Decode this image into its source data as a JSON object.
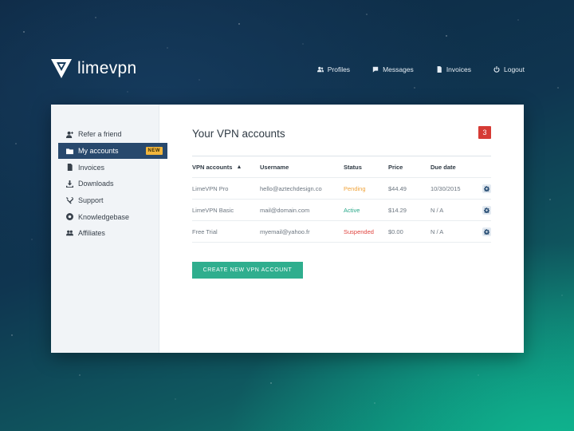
{
  "brand": {
    "name": "limevpn"
  },
  "nav": [
    {
      "label": "Profiles",
      "icon": "users-icon"
    },
    {
      "label": "Messages",
      "icon": "chat-icon"
    },
    {
      "label": "Invoices",
      "icon": "document-icon"
    },
    {
      "label": "Logout",
      "icon": "power-icon"
    }
  ],
  "sidebar": {
    "items": [
      {
        "label": "Refer a friend",
        "icon": "add-user-icon"
      },
      {
        "label": "My accounts",
        "icon": "folder-icon",
        "active": true,
        "badge": "NEW"
      },
      {
        "label": "Invoices",
        "icon": "document-icon"
      },
      {
        "label": "Downloads",
        "icon": "download-icon"
      },
      {
        "label": "Support",
        "icon": "tools-icon"
      },
      {
        "label": "Knowledgebase",
        "icon": "lifebuoy-icon"
      },
      {
        "label": "Affiliates",
        "icon": "group-icon"
      }
    ]
  },
  "main": {
    "title": "Your VPN accounts",
    "count": "3",
    "table": {
      "headers": [
        "VPN accounts",
        "Username",
        "Status",
        "Price",
        "Due date"
      ],
      "rows": [
        {
          "account": "LimeVPN Pro",
          "username": "hello@aztechdesign.co",
          "status": "Pending",
          "price": "$44.49",
          "due": "10/30/2015"
        },
        {
          "account": "LimeVPN Basic",
          "username": "mail@domain.com",
          "status": "Active",
          "price": "$14.29",
          "due": "N / A"
        },
        {
          "account": "Free Trial",
          "username": "myemail@yahoo.fr",
          "status": "Suspended",
          "price": "$0.00",
          "due": "N / A"
        }
      ]
    },
    "create_button": "CREATE NEW VPN ACCOUNT"
  },
  "colors": {
    "accent": "#2fae8e",
    "sidebar_active": "#28496d",
    "badge_red": "#d63b35",
    "badge_new": "#f2b63c",
    "pending": "#f0a33a",
    "active": "#2aa88a",
    "suspended": "#e0443f"
  }
}
